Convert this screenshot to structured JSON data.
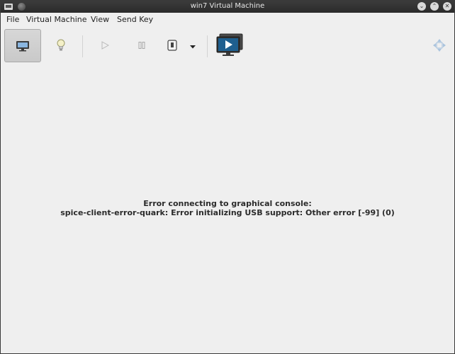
{
  "window": {
    "title": "win7 Virtual Machine",
    "buttons": [
      {
        "name": "minimize-button",
        "glyph": "⌄"
      },
      {
        "name": "maximize-button",
        "glyph": "⌃"
      },
      {
        "name": "close-button",
        "glyph": "✕"
      }
    ]
  },
  "menubar": {
    "items": [
      "File",
      "Virtual Machine",
      "View",
      "Send Key"
    ]
  },
  "toolbar": {
    "items": [
      {
        "name": "console-view",
        "icon": "monitor-icon",
        "active": true
      },
      {
        "name": "details-view",
        "icon": "lightbulb-icon"
      },
      {
        "name": "run-button",
        "icon": "play-icon"
      },
      {
        "name": "pause-button",
        "icon": "pause-icon"
      },
      {
        "name": "shutdown-button",
        "icon": "power-icon"
      },
      {
        "name": "shutdown-menu",
        "icon": "chevron-down-icon"
      },
      {
        "name": "snapshots-button",
        "icon": "snapshot-play-icon"
      },
      {
        "name": "fullscreen-button",
        "icon": "fullscreen-arrows-icon"
      }
    ]
  },
  "console": {
    "error_line1": "Error connecting to graphical console:",
    "error_line2": "spice-client-error-quark: Error initializing USB support: Other error [-99] (0)"
  }
}
